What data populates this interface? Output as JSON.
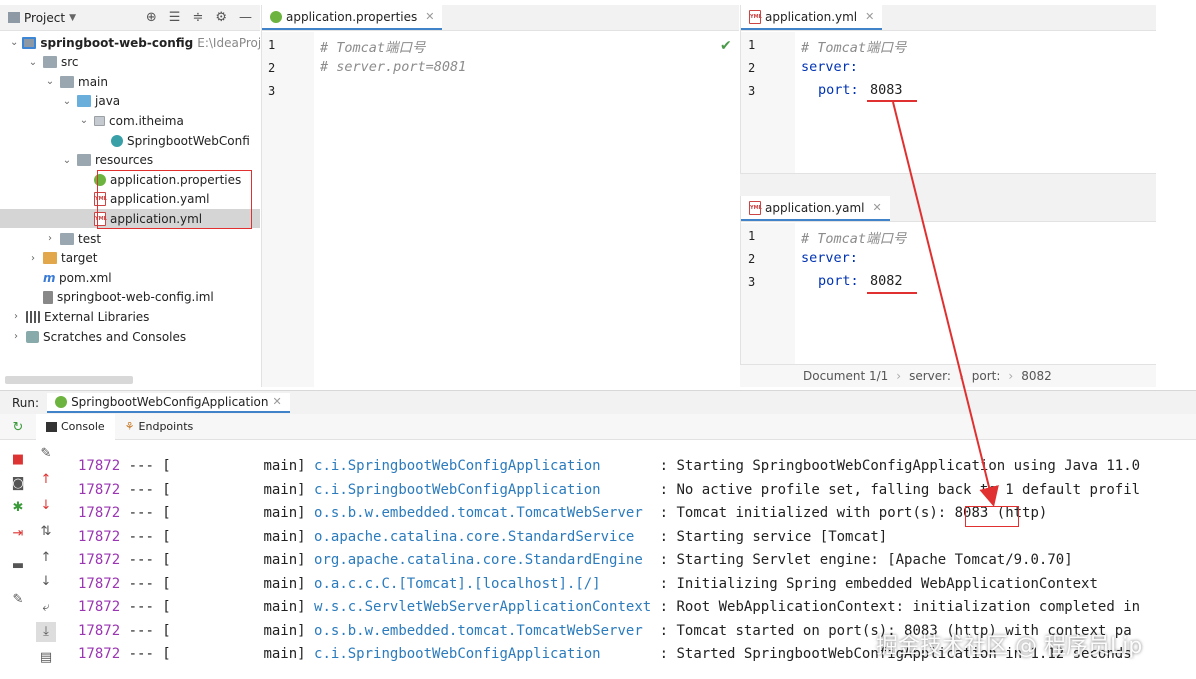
{
  "project": {
    "title": "Project",
    "tree": [
      {
        "label": "springboot-web-config",
        "hint": "E:\\IdeaProje",
        "depth": 0,
        "chev": "v",
        "icon": "module",
        "bold": true
      },
      {
        "label": "src",
        "depth": 1,
        "chev": "v",
        "icon": "folder"
      },
      {
        "label": "main",
        "depth": 2,
        "chev": "v",
        "icon": "folder"
      },
      {
        "label": "java",
        "depth": 3,
        "chev": "v",
        "icon": "folder-blue"
      },
      {
        "label": "com.itheima",
        "depth": 4,
        "chev": "v",
        "icon": "pkg"
      },
      {
        "label": "SpringbootWebConfi",
        "depth": 5,
        "chev": "",
        "icon": "class"
      },
      {
        "label": "resources",
        "depth": 3,
        "chev": "v",
        "icon": "folder"
      },
      {
        "label": "application.properties",
        "depth": 4,
        "chev": "",
        "icon": "props"
      },
      {
        "label": "application.yaml",
        "depth": 4,
        "chev": "",
        "icon": "yml"
      },
      {
        "label": "application.yml",
        "depth": 4,
        "chev": "",
        "icon": "yml",
        "selected": true
      },
      {
        "label": "test",
        "depth": 2,
        "chev": ">",
        "icon": "folder"
      },
      {
        "label": "target",
        "depth": 1,
        "chev": ">",
        "icon": "folder-orange"
      },
      {
        "label": "pom.xml",
        "depth": 1,
        "chev": "",
        "icon": "maven"
      },
      {
        "label": "springboot-web-config.iml",
        "depth": 1,
        "chev": "",
        "icon": "iml"
      },
      {
        "label": "External Libraries",
        "depth": 0,
        "chev": ">",
        "icon": "lib"
      },
      {
        "label": "Scratches and Consoles",
        "depth": 0,
        "chev": ">",
        "icon": "scratch"
      }
    ]
  },
  "editor_props": {
    "tab": "application.properties",
    "lines": [
      {
        "n": "1",
        "text": "# Tomcat端口号",
        "cls": "comment"
      },
      {
        "n": "2",
        "text": "# server.port=8081",
        "cls": "comment"
      },
      {
        "n": "3",
        "text": "",
        "cls": "plain"
      }
    ]
  },
  "editor_yml": {
    "tab": "application.yml",
    "comment": "# Tomcat端口号",
    "server": "server:",
    "port_key": "port:",
    "port_val": "8083"
  },
  "editor_yaml": {
    "tab": "application.yaml",
    "comment": "# Tomcat端口号",
    "server": "server:",
    "port_key": "port:",
    "port_val": "8082"
  },
  "breadcrumb": [
    "Document 1/1",
    "server:",
    "port:",
    "8082"
  ],
  "run": {
    "label": "Run:",
    "config": "SpringbootWebConfigApplication",
    "subtabs": [
      "Console",
      "Endpoints"
    ],
    "log": [
      {
        "pid": "17872",
        "sep": " --- [           main] ",
        "logger": "c.i.SpringbootWebConfigApplication      ",
        "msg": " : Starting SpringbootWebConfigApplication using Java 11.0"
      },
      {
        "pid": "17872",
        "sep": " --- [           main] ",
        "logger": "c.i.SpringbootWebConfigApplication      ",
        "msg": " : No active profile set, falling back to 1 default profil"
      },
      {
        "pid": "17872",
        "sep": " --- [           main] ",
        "logger": "o.s.b.w.embedded.tomcat.TomcatWebServer ",
        "msg": " : Tomcat initialized with port(s): 8083 (http)"
      },
      {
        "pid": "17872",
        "sep": " --- [           main] ",
        "logger": "o.apache.catalina.core.StandardService  ",
        "msg": " : Starting service [Tomcat]"
      },
      {
        "pid": "17872",
        "sep": " --- [           main] ",
        "logger": "org.apache.catalina.core.StandardEngine ",
        "msg": " : Starting Servlet engine: [Apache Tomcat/9.0.70]"
      },
      {
        "pid": "17872",
        "sep": " --- [           main] ",
        "logger": "o.a.c.c.C.[Tomcat].[localhost].[/]      ",
        "msg": " : Initializing Spring embedded WebApplicationContext"
      },
      {
        "pid": "17872",
        "sep": " --- [           main] ",
        "logger": "w.s.c.ServletWebServerApplicationContext",
        "msg": " : Root WebApplicationContext: initialization completed in"
      },
      {
        "pid": "17872",
        "sep": " --- [           main] ",
        "logger": "o.s.b.w.embedded.tomcat.TomcatWebServer ",
        "msg": " : Tomcat started on port(s): 8083 (http) with context pa"
      },
      {
        "pid": "17872",
        "sep": " --- [           main] ",
        "logger": "c.i.SpringbootWebConfigApplication      ",
        "msg": " : Started SpringbootWebConfigApplication in 1.12 seconds"
      }
    ]
  },
  "watermark": "掘金技术社区 @ 程序员Lip"
}
